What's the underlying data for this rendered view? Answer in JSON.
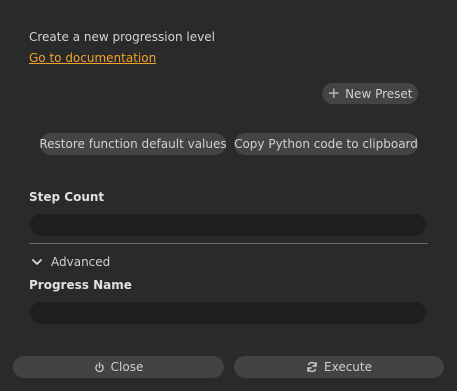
{
  "description": "Create a new progression level",
  "doc_link": "Go to documentation",
  "new_preset": "New Preset",
  "restore_label": "Restore function default values",
  "copy_label": "Copy Python code to clipboard",
  "step_count": {
    "label": "Step Count",
    "value": ""
  },
  "advanced": {
    "label": "Advanced",
    "expanded": true
  },
  "progress_name": {
    "label": "Progress Name",
    "value": ""
  },
  "footer": {
    "close": "Close",
    "execute": "Execute"
  },
  "icons": {
    "new_preset": "plus-icon",
    "advanced": "chevron-down-icon",
    "close": "power-icon",
    "execute": "refresh-icon"
  },
  "colors": {
    "background": "#2a2a2a",
    "link": "#f0a32a",
    "button": "#444444",
    "field": "#1f1f1f"
  }
}
